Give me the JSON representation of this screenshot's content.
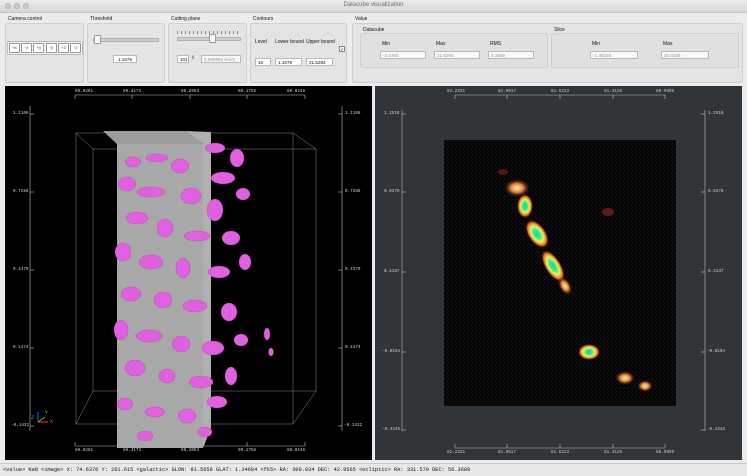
{
  "window": {
    "title": "Datacube visualization"
  },
  "camera": {
    "label": "Camera control",
    "buttons": [
      "+x",
      "-x",
      "+y",
      "-y",
      "+z",
      "-z"
    ]
  },
  "threshold": {
    "label": "Threshold",
    "value": "1.1676",
    "position": 0.05
  },
  "cutting_plane": {
    "label": "Cutting plane",
    "slice": "101",
    "velocity": "0.665855 Km/s",
    "position": 0.55
  },
  "contours": {
    "label": "Contours",
    "level_label": "Level",
    "lower_label": "Lower bound",
    "upper_label": "Upper bound",
    "level": "15",
    "lower": "1.1676",
    "upper": "21.5284",
    "checked": true
  },
  "value": {
    "label": "Value",
    "datacube": {
      "label": "Datacube",
      "min_label": "Min",
      "max_label": "Max",
      "rms_label": "RMS",
      "min": "-2.1382",
      "max": "21.5284",
      "rms": "0.3659"
    },
    "slice": {
      "label": "Slice",
      "min_label": "Min",
      "max_label": "Max",
      "min": "-1.39236",
      "max": "20.0326"
    }
  },
  "left_view": {
    "top_axis": [
      "80.8261",
      "80.4172",
      "80.2063",
      "80.1755",
      "80.0246"
    ],
    "bottom_axis": [
      "80.8261",
      "80.4172",
      "80.2063",
      "80.1755",
      "80.0246"
    ],
    "left_axis": [
      "1.1106",
      "0.7286",
      "0.4379",
      "0.1474",
      "-0.1432"
    ],
    "right_axis": [
      "1.1106",
      "0.7286",
      "0.4379",
      "0.1474",
      "-0.1432"
    ],
    "axes_labels": [
      "Z",
      "Y",
      "X"
    ]
  },
  "right_view": {
    "top_axis": [
      "82.2331",
      "81.9017",
      "81.5313",
      "81.3125",
      "80.9999"
    ],
    "bottom_axis": [
      "82.2331",
      "81.9017",
      "81.5313",
      "81.3125",
      "80.9999"
    ],
    "left_axis": [
      "1.2518",
      "0.8379",
      "0.4137",
      "-0.0104",
      "-0.4345"
    ],
    "right_axis": [
      "1.2518",
      "0.8378",
      "0.4137",
      "-0.0104",
      "-0.4345"
    ]
  },
  "status": {
    "text": "<value> NaN <image> X: 74.6376 Y: 261.615 <galactic> GLON: 81.5658 GLAT: 1.34684 <fk5> RA: 309.034 DEC: 42.9565 <ecliptic> RA: 331.579 DEC: 56.3688"
  },
  "colors": {
    "blob": "#e060e0",
    "slab": "#a8a8a8",
    "left_bg": "#000000",
    "right_bg": "#2f3538",
    "chrome": "#ececec"
  }
}
